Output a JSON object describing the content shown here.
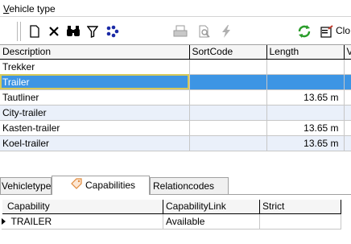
{
  "window": {
    "title_accel": "V",
    "title_rest": "ehicle type"
  },
  "toolbar": {
    "close_label": "Clo",
    "icons": [
      "new-icon",
      "delete-icon",
      "find-icon",
      "filter-icon",
      "options-icon",
      "print-icon",
      "print-preview-icon",
      "lightning-icon",
      "refresh-icon",
      "close-icon"
    ]
  },
  "grid": {
    "columns": [
      "Description",
      "SortCode",
      "Length",
      "V"
    ],
    "rows": [
      {
        "description": "Trekker",
        "sortcode": "",
        "length": ""
      },
      {
        "description": "Trailer",
        "sortcode": "",
        "length": ""
      },
      {
        "description": "Tautliner",
        "sortcode": "",
        "length": "13.65 m"
      },
      {
        "description": "City-trailer",
        "sortcode": "",
        "length": ""
      },
      {
        "description": "Kasten-trailer",
        "sortcode": "",
        "length": "13.65 m"
      },
      {
        "description": "Koel-trailer",
        "sortcode": "",
        "length": "13.65 m"
      }
    ],
    "selected_row": "Trailer"
  },
  "tabs": [
    "Vehicletype",
    "Capabilities",
    "Relationcodes"
  ],
  "active_tab": "Capabilities",
  "capabilities": {
    "columns": [
      "Capability",
      "CapabilityLink",
      "Strict"
    ],
    "rows": [
      {
        "capability": "TRAILER",
        "link": "Available",
        "strict": ""
      }
    ]
  },
  "colors": {
    "selection": "#3d95e4",
    "alt_row": "#eaf0fa",
    "focus_border": "#d6c95a"
  }
}
